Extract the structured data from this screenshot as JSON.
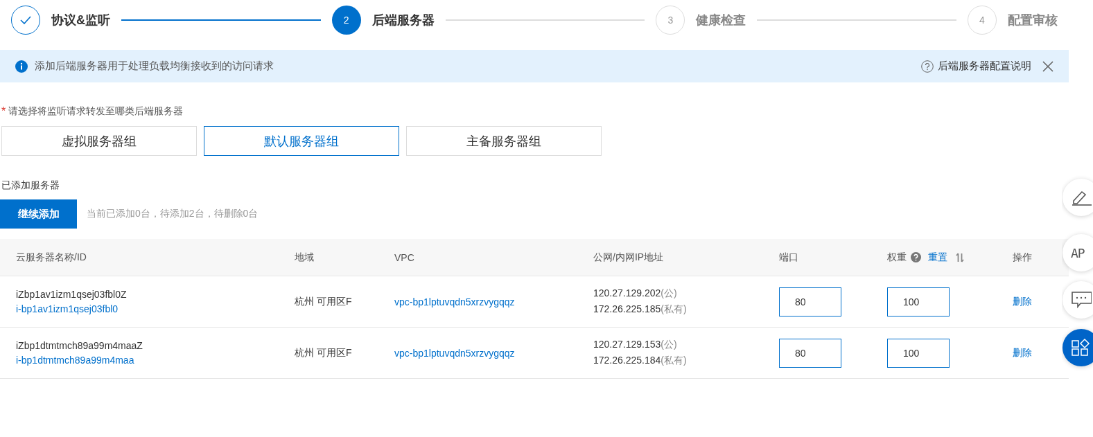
{
  "steps": [
    {
      "label": "协议&监听",
      "completed": true,
      "current": false
    },
    {
      "number": "2",
      "label": "后端服务器",
      "completed": false,
      "current": true
    },
    {
      "number": "3",
      "label": "健康检查",
      "completed": false,
      "current": false
    },
    {
      "number": "4",
      "label": "配置审核",
      "completed": false,
      "current": false
    }
  ],
  "alert": {
    "message": "添加后端服务器用于处理负载均衡接收到的访问请求",
    "help_link": "后端服务器配置说明"
  },
  "group_choice": {
    "required_mark": "*",
    "label": "请选择将监听请求转发至哪类后端服务器",
    "options": [
      {
        "label": "虚拟服务器组",
        "selected": false
      },
      {
        "label": "默认服务器组",
        "selected": true
      },
      {
        "label": "主备服务器组",
        "selected": false
      }
    ]
  },
  "added_servers": {
    "label": "已添加服务器",
    "add_button": "继续添加",
    "summary": "当前已添加0台，待添加2台，待删除0台"
  },
  "table": {
    "columns": [
      "云服务器名称/ID",
      "地域",
      "VPC",
      "公网/内网IP地址",
      "端口",
      "权重"
    ],
    "reset_link": "重置",
    "ops_column": "操作",
    "rows": [
      {
        "name": "iZbp1av1izm1qsej03fbl0Z",
        "id": "i-bp1av1izm1qsej03fbl0",
        "region": "杭州 可用区F",
        "vpc": "vpc-bp1lptuvqdn5xrzvygqqz",
        "public_ip": "120.27.129.202",
        "public_tag": "(公)",
        "private_ip": "172.26.225.185",
        "private_tag": "(私有)",
        "port": "80",
        "weight": "100",
        "action": "删除"
      },
      {
        "name": "iZbp1dtmtmch89a99m4maaZ",
        "id": "i-bp1dtmtmch89a99m4maa",
        "region": "杭州 可用区F",
        "vpc": "vpc-bp1lptuvqdn5xrzvygqqz",
        "public_ip": "120.27.129.153",
        "public_tag": "(公)",
        "private_ip": "172.26.225.184",
        "private_tag": "(私有)",
        "port": "80",
        "weight": "100",
        "action": "删除"
      }
    ]
  },
  "float_tools": [
    {
      "kind": "edit"
    },
    {
      "kind": "api",
      "label": "AP"
    },
    {
      "kind": "chat"
    },
    {
      "kind": "apps"
    }
  ]
}
